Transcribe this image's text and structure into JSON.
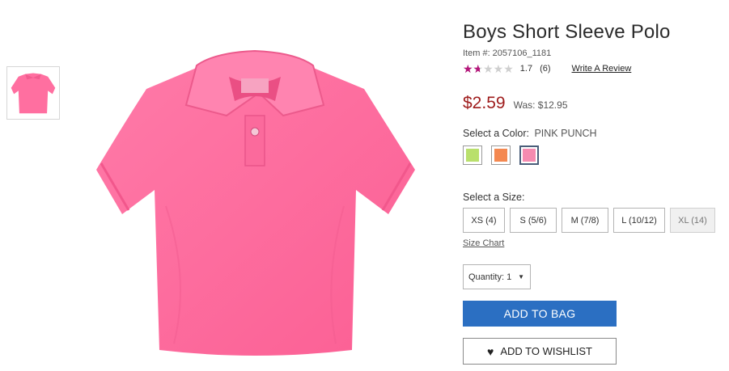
{
  "product": {
    "title": "Boys Short Sleeve Polo",
    "item_number": "Item #: 2057106_1181",
    "rating": {
      "value": "1.7",
      "count": "(6)",
      "max_stars": 5,
      "fill_fraction": 0.34
    },
    "write_review_label": "Write A Review",
    "price": "$2.59",
    "was_price": "Was: $12.95"
  },
  "color": {
    "label": "Select a Color:",
    "selected_name": "PINK PUNCH",
    "swatches": [
      "#b9e06c",
      "#f48850",
      "#f58bb0"
    ],
    "selected_index": 2
  },
  "size": {
    "label": "Select a Size:",
    "options": [
      "XS (4)",
      "S (5/6)",
      "M (7/8)",
      "L (10/12)",
      "XL (14)"
    ],
    "disabled": [
      "XL (14)"
    ],
    "chart_label": "Size Chart"
  },
  "quantity": {
    "label": "Quantity: 1",
    "caret": "▼"
  },
  "buttons": {
    "add_to_bag": "ADD TO BAG",
    "add_to_wishlist": "ADD TO WISHLIST",
    "heart": "♥"
  },
  "colors": {
    "shirt": "#ff6fa0",
    "shirt_shade": "#f25b8f",
    "price_red": "#9e1b1b",
    "star_magenta": "#b5157a",
    "button_blue": "#2b6fc2"
  },
  "icons": [
    "heart-icon",
    "star-icon",
    "dropdown-caret-icon"
  ]
}
